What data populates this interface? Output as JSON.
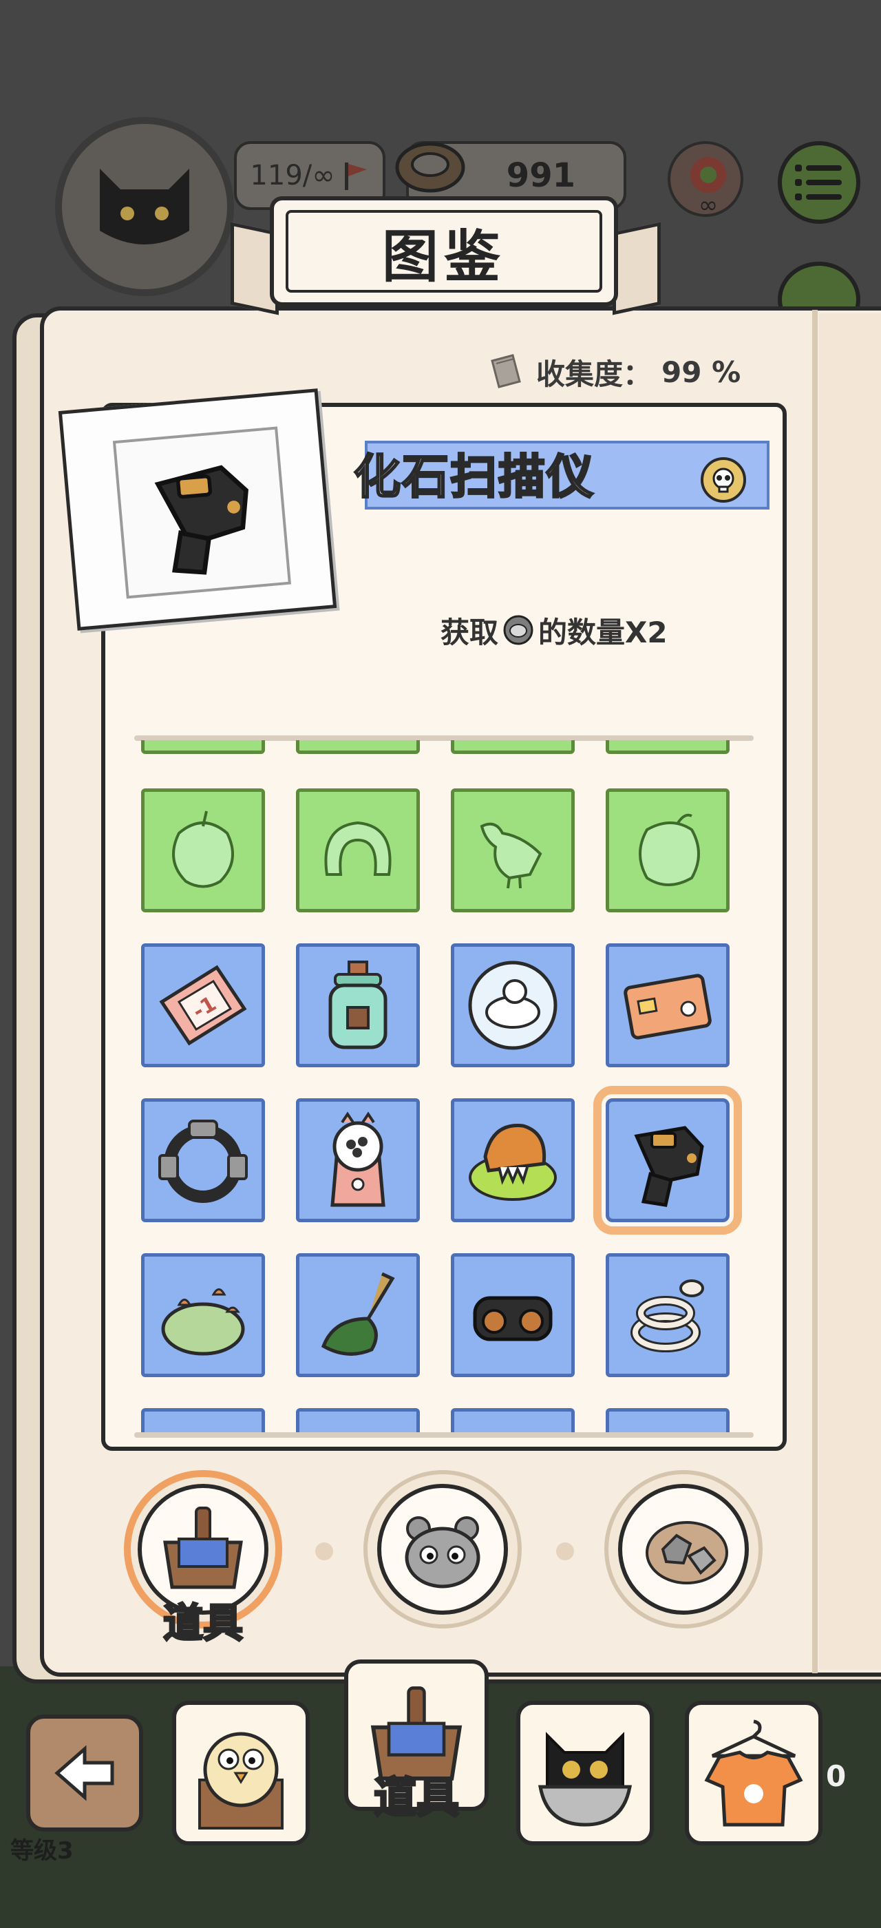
{
  "hud": {
    "stamina": "119/∞",
    "coins": "991"
  },
  "book": {
    "title": "图鉴",
    "collect_label": "收集度：",
    "collect_value": "99 %"
  },
  "detail": {
    "item_name": "化石扫描仪",
    "desc_prefix": "获取",
    "desc_suffix": "的数量X2"
  },
  "grid": {
    "rows": [
      {
        "state": "locked",
        "items": [
          "apple-silhouette",
          "ring-silhouette",
          "bird-silhouette",
          "fruit-silhouette"
        ]
      },
      {
        "state": "collected",
        "items": [
          "ticket-minus-one",
          "jar-with-cube",
          "sheep-bubble",
          "id-card"
        ]
      },
      {
        "state": "collected",
        "items": [
          "ring-gauntlet",
          "capsule-machine",
          "lion-on-grass",
          "fossil-scanner"
        ]
      },
      {
        "state": "collected",
        "items": [
          "mushroom-bush",
          "leaf-broom",
          "binoculars",
          "coiled-snake"
        ]
      }
    ],
    "selected": "fossil-scanner"
  },
  "categories": {
    "active": "道具",
    "tabs": [
      "items",
      "animals",
      "minerals"
    ]
  },
  "nav": {
    "items_label": "道具"
  },
  "footer": {
    "level": "等级3",
    "side_value": "0"
  },
  "colors": {
    "locked_cell": "#9ee07f",
    "collected_cell": "#8fb3f0",
    "selected_outline": "#f3b57b",
    "name_bar": "#9fbcf4",
    "page_bg": "#f7ece0"
  }
}
